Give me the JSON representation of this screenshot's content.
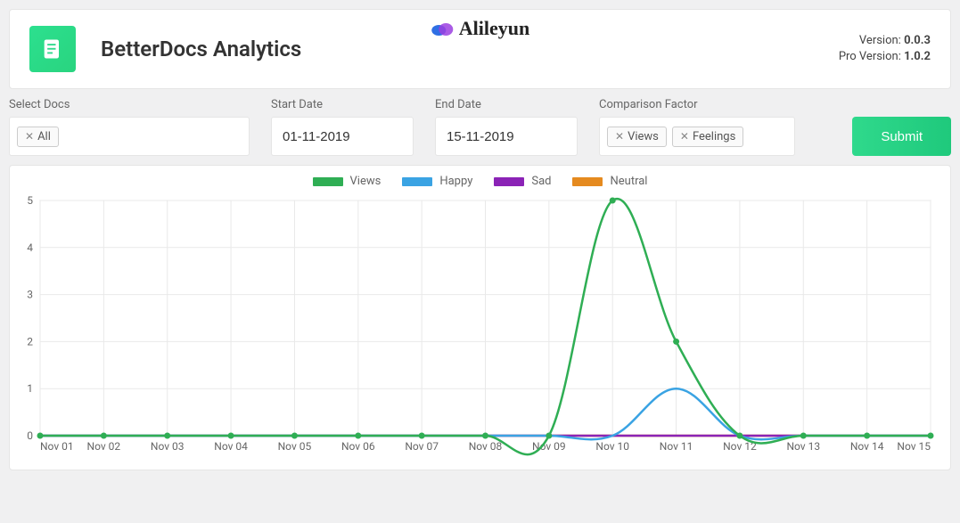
{
  "header": {
    "title": "BetterDocs Analytics",
    "brand": "Alileyun",
    "version_label": "Version:",
    "version_value": "0.0.3",
    "pro_version_label": "Pro Version:",
    "pro_version_value": "1.0.2"
  },
  "filters": {
    "select_docs_label": "Select Docs",
    "select_docs_tags": [
      "All"
    ],
    "start_date_label": "Start Date",
    "start_date_value": "01-11-2019",
    "end_date_label": "End Date",
    "end_date_value": "15-11-2019",
    "comparison_label": "Comparison Factor",
    "comparison_tags": [
      "Views",
      "Feelings"
    ],
    "submit_label": "Submit"
  },
  "chart_data": {
    "type": "line",
    "categories": [
      "Nov 01",
      "Nov 02",
      "Nov 03",
      "Nov 04",
      "Nov 05",
      "Nov 06",
      "Nov 07",
      "Nov 08",
      "Nov 09",
      "Nov 10",
      "Nov 11",
      "Nov 12",
      "Nov 13",
      "Nov 14",
      "Nov 15"
    ],
    "series": [
      {
        "name": "Views",
        "color": "#2fae54",
        "values": [
          0,
          0,
          0,
          0,
          0,
          0,
          0,
          0,
          0,
          5,
          2,
          0,
          0,
          0,
          0
        ]
      },
      {
        "name": "Happy",
        "color": "#3aa3e3",
        "values": [
          0,
          0,
          0,
          0,
          0,
          0,
          0,
          0,
          0,
          0,
          1,
          0,
          0,
          0,
          0
        ]
      },
      {
        "name": "Sad",
        "color": "#8b23b6",
        "values": [
          0,
          0,
          0,
          0,
          0,
          0,
          0,
          0,
          0,
          0,
          0,
          0,
          0,
          0,
          0
        ]
      },
      {
        "name": "Neutral",
        "color": "#e58a1f",
        "values": [
          0,
          0,
          0,
          0,
          0,
          0,
          0,
          0,
          0,
          0,
          0,
          0,
          0,
          0,
          0
        ]
      }
    ],
    "ylim": [
      0,
      5
    ],
    "yticks": [
      0,
      1,
      2,
      3,
      4,
      5
    ],
    "xlabel": "",
    "ylabel": "",
    "title": ""
  }
}
